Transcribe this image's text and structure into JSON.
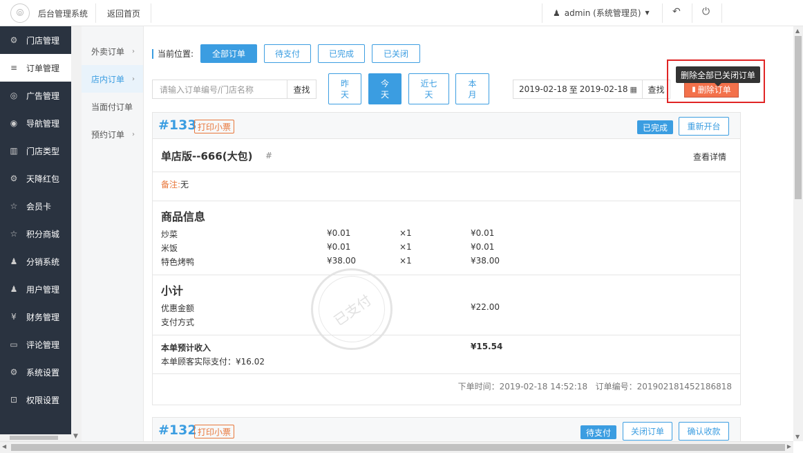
{
  "header": {
    "title": "后台管理系统",
    "back_home": "返回首页",
    "user": "admin (系统管理员)",
    "icons": [
      "user-icon",
      "caret-down-icon",
      "undo-icon",
      "power-icon"
    ]
  },
  "sidebar": {
    "items": [
      {
        "label": "门店管理",
        "icon": "stores-icon",
        "glyph": "⚙"
      },
      {
        "label": "订单管理",
        "icon": "list-icon",
        "glyph": "≡"
      },
      {
        "label": "广告管理",
        "icon": "ad-icon",
        "glyph": "◎"
      },
      {
        "label": "导航管理",
        "icon": "compass-icon",
        "glyph": "◉"
      },
      {
        "label": "门店类型",
        "icon": "bank-icon",
        "glyph": "▥"
      },
      {
        "label": "天降红包",
        "icon": "gift-icon",
        "glyph": "⚙"
      },
      {
        "label": "会员卡",
        "icon": "star-icon",
        "glyph": "☆"
      },
      {
        "label": "积分商城",
        "icon": "star-icon",
        "glyph": "☆"
      },
      {
        "label": "分销系统",
        "icon": "users-icon",
        "glyph": "♟"
      },
      {
        "label": "用户管理",
        "icon": "user-icon",
        "glyph": "♟"
      },
      {
        "label": "财务管理",
        "icon": "yen-icon",
        "glyph": "¥"
      },
      {
        "label": "评论管理",
        "icon": "comment-icon",
        "glyph": "▭"
      },
      {
        "label": "系统设置",
        "icon": "gear-icon",
        "glyph": "⚙"
      },
      {
        "label": "权限设置",
        "icon": "lock-icon",
        "glyph": "🔒"
      }
    ],
    "active_index": 1
  },
  "subnav": {
    "items": [
      "外卖订单",
      "店内订单",
      "当面付订单",
      "预约订单"
    ],
    "active_index": 1
  },
  "filters": {
    "location_label": "当前位置:",
    "status_tabs": [
      "全部订单",
      "待支付",
      "已完成",
      "已关闭"
    ],
    "active_status": 0,
    "search_placeholder": "请输入订单编号/门店名称",
    "search_button": "查找",
    "date_buttons": [
      "昨\n天",
      "今\n天",
      "近七\n天",
      "本\n月"
    ],
    "date_buttons_display": [
      [
        "昨",
        "天"
      ],
      [
        "今",
        "天"
      ],
      [
        "近七",
        "天"
      ],
      [
        "本",
        "月"
      ]
    ],
    "active_date": 1,
    "range_start": "2019-02-18",
    "range_sep": "至",
    "range_end": "2019-02-18",
    "range_search": "查找",
    "delete_button": "删除订单",
    "delete_tooltip": "删除全部已关闭订单"
  },
  "orders": [
    {
      "no": "#133",
      "print_label": "打印小票",
      "status": "已完成",
      "actions": [
        "重新开台"
      ],
      "shop": "单店版--666(大包)",
      "hash": "#",
      "detail_link": "查看详情",
      "remark_label": "备注:",
      "remark_value": "无",
      "goods_title": "商品信息",
      "goods": [
        {
          "name": "炒菜",
          "price": "¥0.01",
          "qty": "×1",
          "total": "¥0.01"
        },
        {
          "name": "米饭",
          "price": "¥0.01",
          "qty": "×1",
          "total": "¥0.01"
        },
        {
          "name": "特色烤鸭",
          "price": "¥38.00",
          "qty": "×1",
          "total": "¥38.00"
        }
      ],
      "subtotal_title": "小计",
      "discount_label": "优惠金额",
      "discount_value": "¥22.00",
      "pay_method_label": "支付方式",
      "income_label": "本单预计收入",
      "income_value": "¥15.54",
      "actual_paid": "本单顾客实际支付：¥16.02",
      "order_time": "下单时间：2019-02-18 14:52:18",
      "order_code": "订单编号：201902181452186818",
      "stamp": "已支付"
    },
    {
      "no": "#132",
      "print_label": "打印小票",
      "status": "待支付",
      "actions": [
        "关闭订单",
        "确认收款"
      ]
    }
  ]
}
